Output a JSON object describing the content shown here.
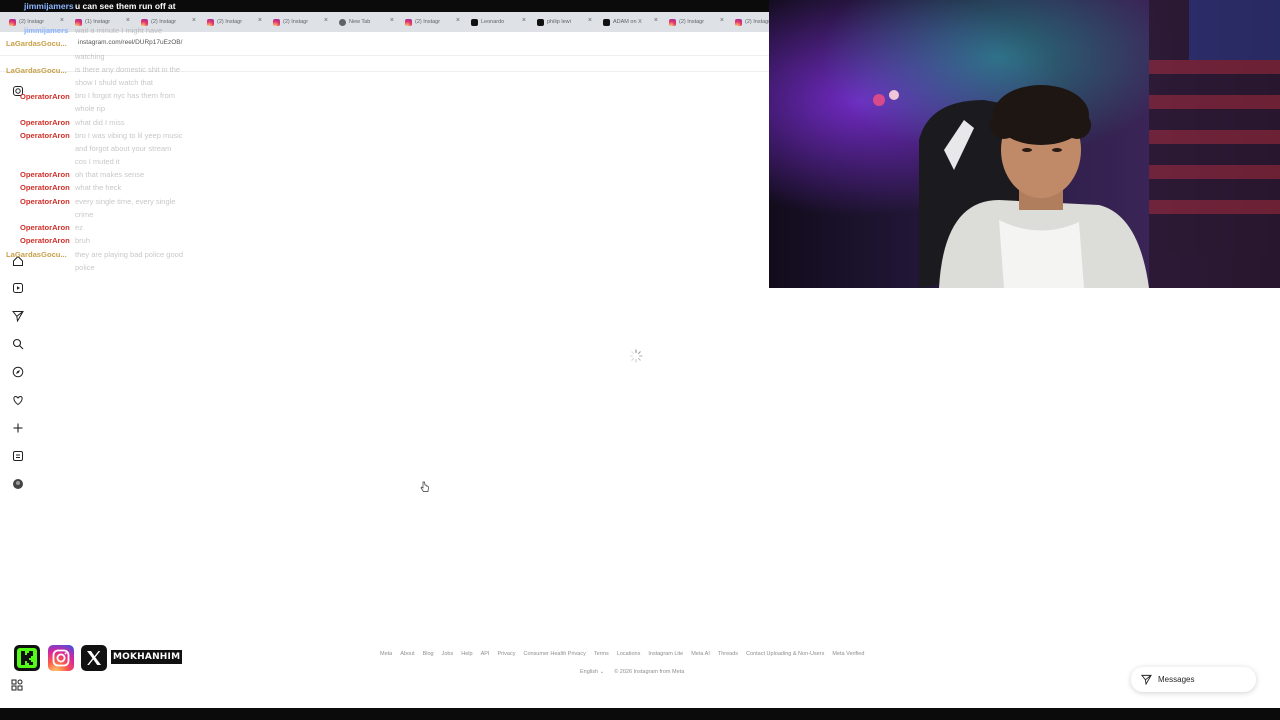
{
  "stream_chat_top": {
    "user": "jimmijamers",
    "message": "u can see them run off at"
  },
  "browser": {
    "tabs": [
      {
        "icon": "instagram-icon",
        "title": "(2) Instagr"
      },
      {
        "icon": "instagram-icon",
        "title": "(1) Instagr"
      },
      {
        "icon": "instagram-icon",
        "title": "(2) Instagr"
      },
      {
        "icon": "instagram-icon",
        "title": "(2) Instagr"
      },
      {
        "icon": "instagram-icon",
        "title": "(2) Instagr"
      },
      {
        "icon": "new-tab-icon",
        "title": "New Tab"
      },
      {
        "icon": "instagram-icon",
        "title": "(2) Instagr"
      },
      {
        "icon": "x-icon",
        "title": "Leonardo"
      },
      {
        "icon": "x-icon",
        "title": "philip lewi"
      },
      {
        "icon": "x-icon",
        "title": "ADAM on X"
      },
      {
        "icon": "instagram-icon",
        "title": "(2) Instagr"
      },
      {
        "icon": "instagram-icon",
        "title": "(2) Instagr"
      }
    ],
    "url": "instagram.com/reel/DURp17uEzOB/"
  },
  "chat": [
    {
      "user": "jimmijamers",
      "color": "#8ab4ff",
      "text": "wait a minute I might have"
    },
    {
      "user": "LaGardasGocu...",
      "color": "#c8a24a",
      "text": "watching"
    },
    {
      "user": "LaGardasGocu...",
      "color": "#c8a24a",
      "text": "is there any domestic shit in the show I shuld watch that"
    },
    {
      "user": "OperatorAron",
      "color": "#d0302a",
      "text": "bro I forgot nyc has them from whole rip"
    },
    {
      "user": "OperatorAron",
      "color": "#d0302a",
      "text": "what did I miss"
    },
    {
      "user": "OperatorAron",
      "color": "#d0302a",
      "text": "bro I was vibing to lil yeep music and forgot about your stream cos I muted it"
    },
    {
      "user": "OperatorAron",
      "color": "#d0302a",
      "text": "oh that makes sense"
    },
    {
      "user": "OperatorAron",
      "color": "#d0302a",
      "text": "what the heck"
    },
    {
      "user": "OperatorAron",
      "color": "#d0302a",
      "text": "every single time, every single crime"
    },
    {
      "user": "OperatorAron",
      "color": "#d0302a",
      "text": "ez"
    },
    {
      "user": "OperatorAron",
      "color": "#d0302a",
      "text": "bruh"
    },
    {
      "user": "LaGardasGocu...",
      "color": "#c8a24a",
      "text": "they are playing bad police good police"
    }
  ],
  "sidebar_icons": [
    "instagram-logo-icon",
    "home-icon",
    "reels-icon",
    "messages-icon",
    "search-icon",
    "explore-icon",
    "notifications-icon",
    "create-icon",
    "dashboard-icon",
    "profile-icon",
    "more-icon"
  ],
  "footer": {
    "links": [
      "Meta",
      "About",
      "Blog",
      "Jobs",
      "Help",
      "API",
      "Privacy",
      "Consumer Health Privacy",
      "Terms",
      "Locations",
      "Instagram Lite",
      "Meta AI",
      "Threads",
      "Contact Uploading & Non-Users",
      "Meta Verified"
    ],
    "language": "English",
    "copyright": "© 2026 Instagram from Meta"
  },
  "streamer": {
    "handle": "MOKHANHIM"
  },
  "messages_button": {
    "label": "Messages"
  }
}
